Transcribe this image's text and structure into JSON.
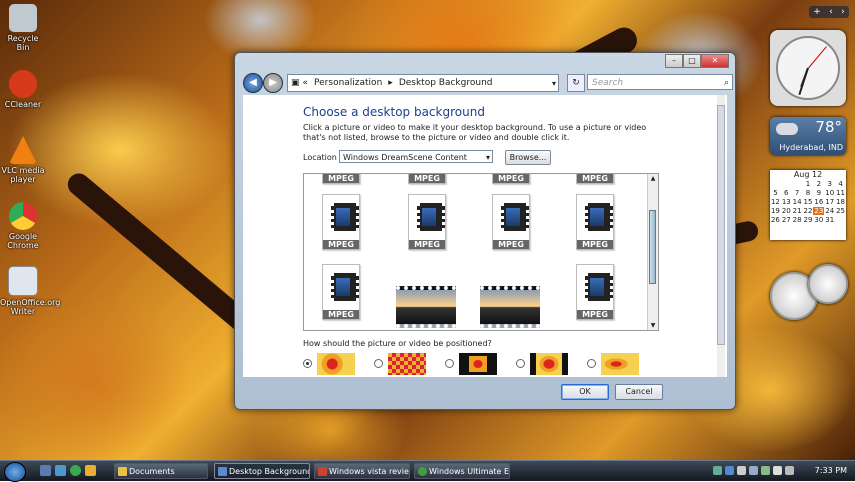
{
  "desktop_icons": [
    {
      "label": "Recycle Bin",
      "icon": "recycle-bin-icon",
      "color": "#c0c8d0"
    },
    {
      "label": "CCleaner",
      "icon": "ccleaner-icon",
      "color": "#d63a1a"
    },
    {
      "label": "VLC media player",
      "icon": "vlc-icon",
      "color": "#f08010"
    },
    {
      "label": "Google Chrome",
      "icon": "chrome-icon",
      "color": "#3aa850"
    },
    {
      "label": "OpenOffice.org Writer",
      "icon": "openoffice-writer-icon",
      "color": "#dfe6ee"
    }
  ],
  "gadgets": {
    "weather": {
      "temp": "78°",
      "city": "Hyderabad, IND"
    },
    "calendar": {
      "month": "Aug 12",
      "days": [
        "",
        "",
        "",
        "1",
        "2",
        "3",
        "4",
        "5",
        "6",
        "7",
        "8",
        "9",
        "10",
        "11",
        "12",
        "13",
        "14",
        "15",
        "16",
        "17",
        "18",
        "19",
        "20",
        "21",
        "22",
        "23",
        "24",
        "25",
        "26",
        "27",
        "28",
        "29",
        "30",
        "31",
        ""
      ],
      "today": "23"
    }
  },
  "window": {
    "breadcrumbs": [
      "Personalization",
      "Desktop Background"
    ],
    "breadcrumb_prefix": "«",
    "search_placeholder": "Search",
    "title": "Choose a desktop background",
    "description": "Click a picture or video to make it your desktop background. To use a picture or video that's not listed, browse to the picture or video and double click it.",
    "location_label": "Location",
    "location_value": "Windows DreamScene Content",
    "browse_label": "Browse...",
    "mpeg_label": "MPEG",
    "position_question": "How should the picture or video be positioned?",
    "ok_label": "OK",
    "cancel_label": "Cancel"
  },
  "taskbar": {
    "tasks": [
      {
        "label": "Documents",
        "color": "#e8c04a",
        "active": false
      },
      {
        "label": "Desktop Background",
        "color": "#5a8ad0",
        "active": true
      },
      {
        "label": "Windows vista revie...",
        "color": "#d04030",
        "active": false
      },
      {
        "label": "Windows Ultimate E...",
        "color": "#40a040",
        "active": false
      }
    ],
    "time": "7:33 PM"
  },
  "colors": {
    "accent": "#1e3f8a",
    "selection": "#2b6ad0"
  }
}
